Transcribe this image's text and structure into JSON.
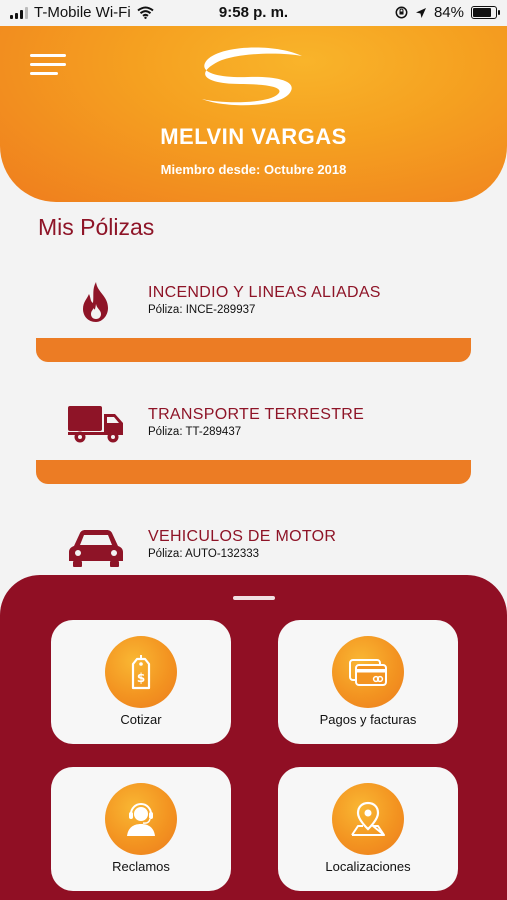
{
  "status_bar": {
    "carrier": "T-Mobile Wi-Fi",
    "time": "9:58 p. m.",
    "battery": "84%",
    "battery_level": 0.84
  },
  "header": {
    "user_name": "MELVIN VARGAS",
    "member_since": "Miembro desde: Octubre 2018"
  },
  "policies_section": {
    "title": "Mis Pólizas",
    "items": [
      {
        "name": "INCENDIO Y LINEAS ALIADAS",
        "number": "Póliza: INCE-289937",
        "icon": "fire-icon"
      },
      {
        "name": "TRANSPORTE TERRESTRE",
        "number": "Póliza: TT-289437",
        "icon": "truck-icon"
      },
      {
        "name": "VEHICULOS DE MOTOR",
        "number": "Póliza: AUTO-132333",
        "icon": "car-icon"
      }
    ]
  },
  "actions": [
    {
      "label": "Cotizar",
      "icon": "price-tag-icon"
    },
    {
      "label": "Pagos y facturas",
      "icon": "credit-card-icon"
    },
    {
      "label": "Reclamos",
      "icon": "support-agent-icon"
    },
    {
      "label": "Localizaciones",
      "icon": "location-pin-icon"
    }
  ],
  "colors": {
    "accent_orange": "#ec7c24",
    "brand_red": "#900f24",
    "title_red": "#8e1427"
  }
}
